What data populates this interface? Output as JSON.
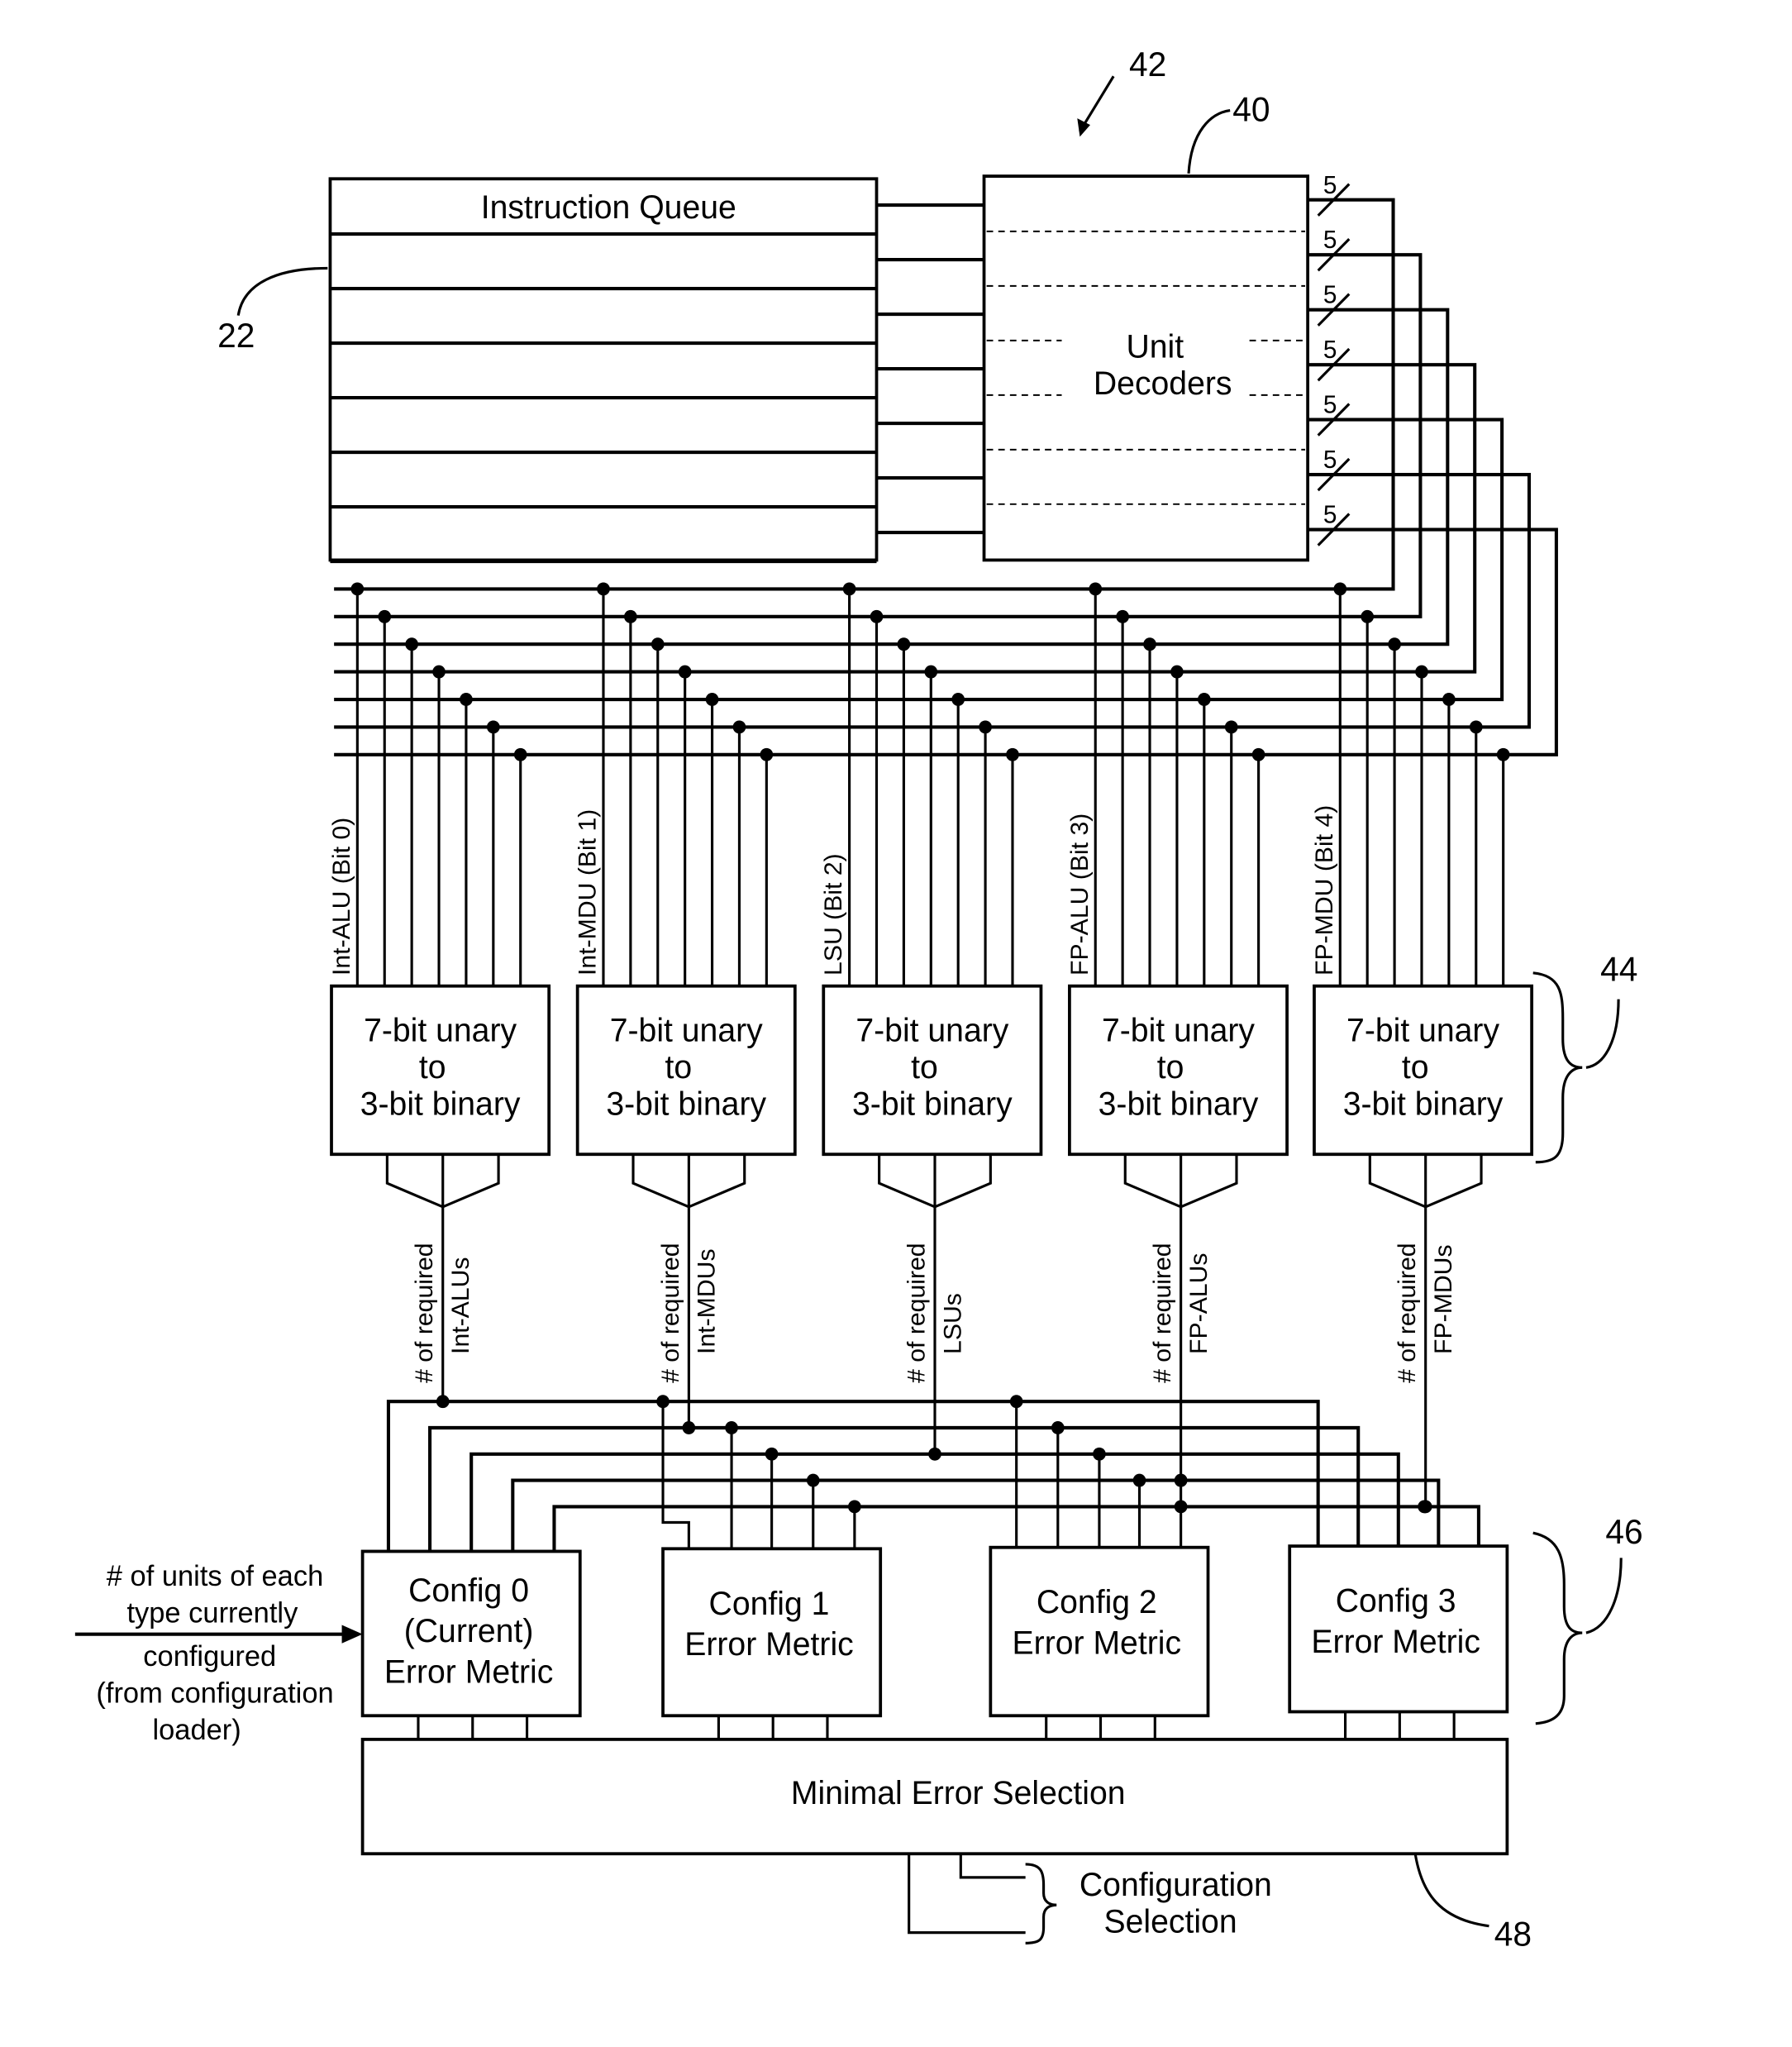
{
  "figure": {
    "reference_numerals": {
      "system": "42",
      "unit_decoders": "40",
      "instruction_queue": "22",
      "converters": "44",
      "error_metrics": "46",
      "minimal_error_selection": "48"
    },
    "instruction_queue": {
      "title": "Instruction Queue",
      "entries": 7
    },
    "unit_decoders": {
      "label_line1": "Unit",
      "label_line2": "Decoders",
      "bus_width_labels": [
        "5",
        "5",
        "5",
        "5",
        "5",
        "5",
        "5"
      ]
    },
    "unit_types": [
      {
        "bit_label": "Int-ALU (Bit 0)",
        "count_label_1": "# of required",
        "count_label_2": "Int-ALUs"
      },
      {
        "bit_label": "Int-MDU (Bit 1)",
        "count_label_1": "# of required",
        "count_label_2": "Int-MDUs"
      },
      {
        "bit_label": "LSU (Bit 2)",
        "count_label_1": "# of required",
        "count_label_2": "LSUs"
      },
      {
        "bit_label": "FP-ALU (Bit 3)",
        "count_label_1": "# of required",
        "count_label_2": "FP-ALUs"
      },
      {
        "bit_label": "FP-MDU (Bit 4)",
        "count_label_1": "# of required",
        "count_label_2": "FP-MDUs"
      }
    ],
    "converter": {
      "line1": "7-bit unary",
      "line2": "to",
      "line3": "3-bit binary"
    },
    "configs": [
      {
        "lines": [
          "Config 0",
          "(Current)",
          "Error Metric"
        ]
      },
      {
        "lines": [
          "Config 1",
          "Error Metric"
        ]
      },
      {
        "lines": [
          "Config 2",
          "Error Metric"
        ]
      },
      {
        "lines": [
          "Config 3",
          "Error Metric"
        ]
      }
    ],
    "current_config_input": {
      "lines": [
        "# of units of each",
        "type currently",
        "configured",
        "(from configuration",
        "loader)"
      ]
    },
    "minimal_error_selection": {
      "label": "Minimal Error Selection"
    },
    "output": {
      "line1": "Configuration",
      "line2": "Selection"
    }
  }
}
